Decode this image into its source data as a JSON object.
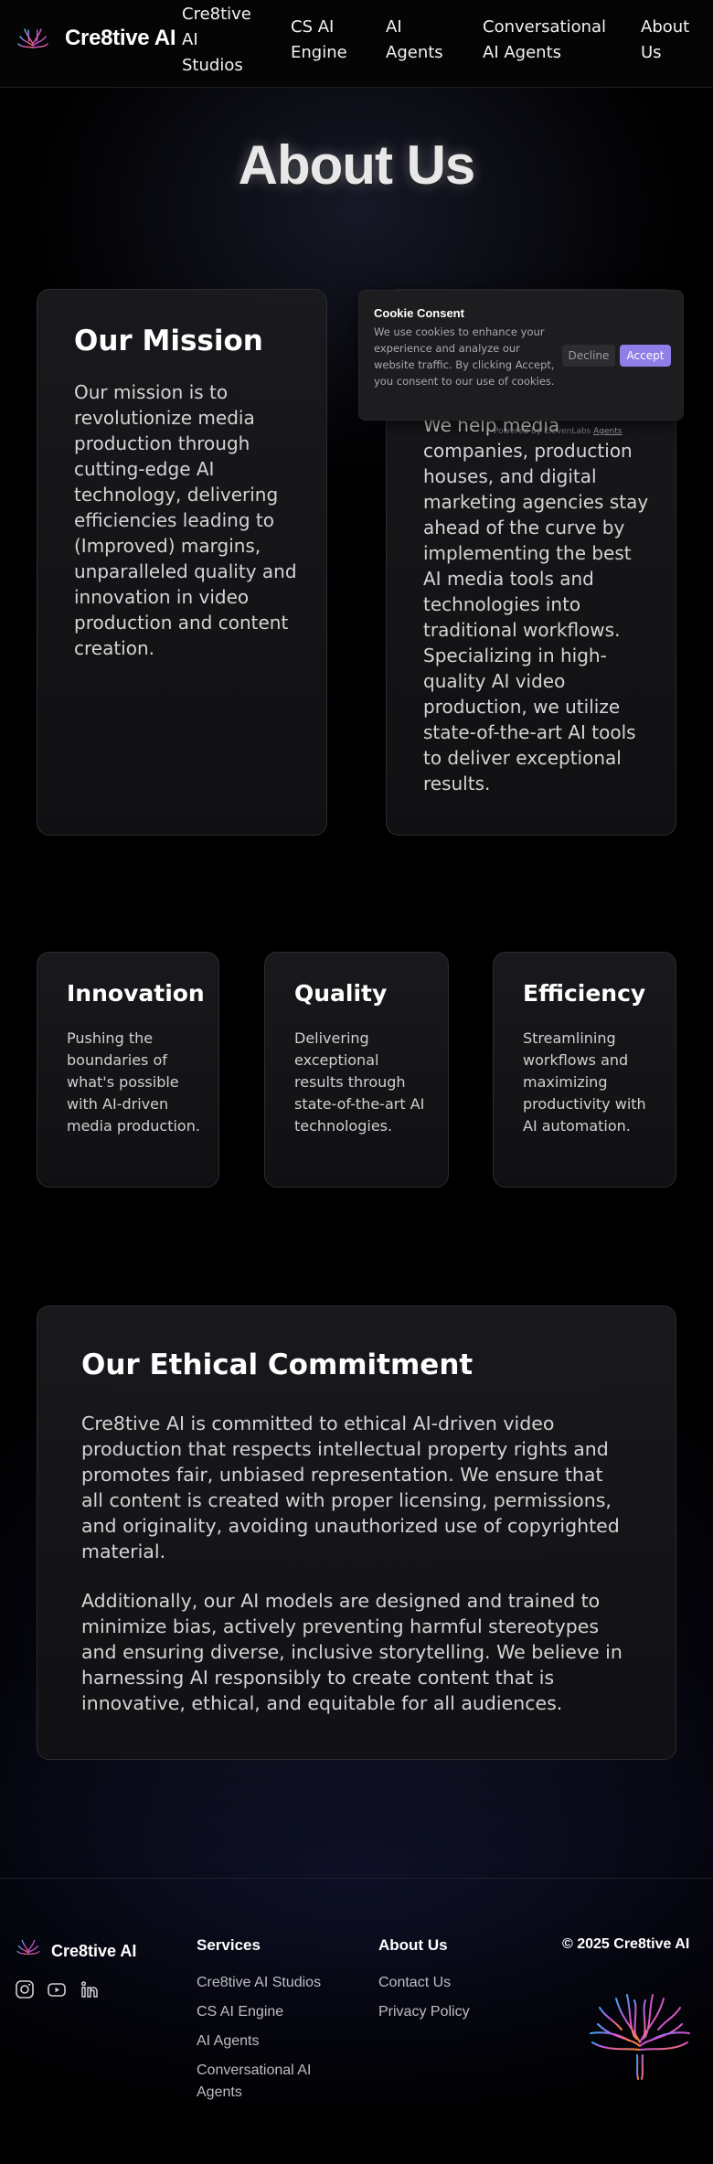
{
  "header": {
    "brand": "Cre8tive AI",
    "nav": [
      {
        "label": "Cre8tive AI Studios"
      },
      {
        "label": "CS AI Engine"
      },
      {
        "label": "AI Agents"
      },
      {
        "label": "Conversational AI Agents"
      },
      {
        "label": "About Us"
      }
    ],
    "icon": "tree-logo-icon"
  },
  "page_title": "About Us",
  "mission": {
    "title": "Our Mission",
    "text": "Our mission is to revolutionize media production through cutting-edge AI technology, delivering efficiencies leading to (Improved) margins, unparalleled quality and innovation in video production and content creation."
  },
  "what_we_do": {
    "text": "We help media companies, production houses, and digital marketing agencies stay ahead of the curve by implementing the best AI media tools and technologies into traditional workflows. Specializing in high-quality AI video production, we utilize state-of-the-art AI tools to deliver exceptional results."
  },
  "values": [
    {
      "title": "Innovation",
      "text": "Pushing the boundaries of what's possible with AI-driven media production."
    },
    {
      "title": "Quality",
      "text": "Delivering exceptional results through state-of-the-art AI technologies."
    },
    {
      "title": "Efficiency",
      "text": "Streamlining workflows and maximizing productivity with AI automation."
    }
  ],
  "ethics": {
    "title": "Our Ethical Commitment",
    "p1": "Cre8tive AI is committed to ethical AI-driven video production that respects intellectual property rights and promotes fair, unbiased representation. We ensure that all content is created with proper licensing, permissions, and originality, avoiding unauthorized use of copyrighted material.",
    "p2": "Additionally, our AI models are designed and trained to minimize bias, actively preventing harmful stereotypes and ensuring diverse, inclusive storytelling. We believe in harnessing AI responsibly to create content that is innovative, ethical, and equitable for all audiences."
  },
  "cookie": {
    "title": "Cookie Consent",
    "text": "We use cookies to enhance your experience and analyze our website traffic. By clicking Accept, you consent to our use of cookies.",
    "decline": "Decline",
    "accept": "Accept",
    "accent_color": "#8f7ee8"
  },
  "powered_by": {
    "prefix": "Powered by ElevenLabs",
    "link": "Agents"
  },
  "footer": {
    "brand": "Cre8tive AI",
    "social_icons": [
      "instagram-icon",
      "youtube-icon",
      "linkedin-icon"
    ],
    "services_heading": "Services",
    "services": [
      "Cre8tive AI Studios",
      "CS AI Engine",
      "AI Agents",
      "Conversational AI Agents"
    ],
    "about_heading": "About Us",
    "about_links": [
      "Contact Us",
      "Privacy Policy"
    ],
    "copyright": "© 2025 Cre8tive AI"
  }
}
